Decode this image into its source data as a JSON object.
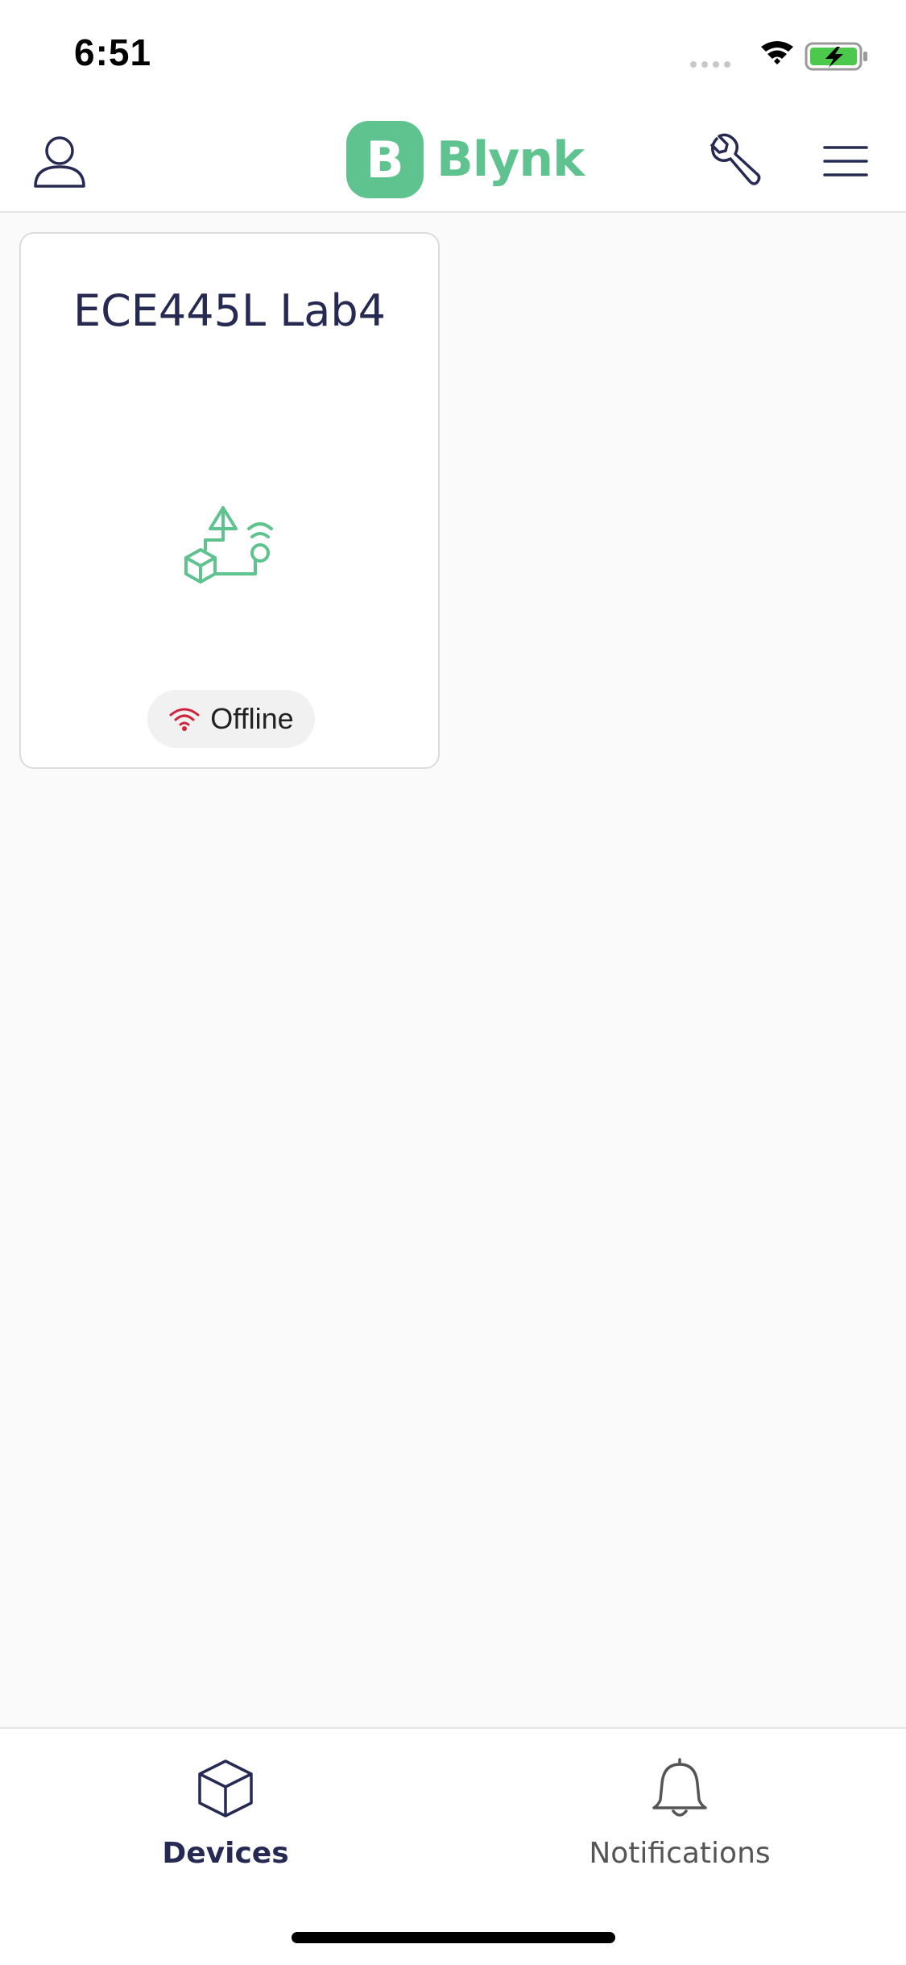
{
  "status_bar": {
    "time": "6:51",
    "icons": [
      "signal-icon",
      "wifi-icon",
      "battery-charging-icon"
    ]
  },
  "header": {
    "logo_badge": "B",
    "logo_text": "Blynk",
    "icons": [
      "profile-icon",
      "wrench-icon",
      "menu-icon"
    ]
  },
  "devices": [
    {
      "name": "ECE445L Lab4",
      "status": "Offline",
      "status_icon": "wifi-off-icon",
      "illustration": "device-template-icon"
    }
  ],
  "tabbar": {
    "tabs": [
      {
        "label": "Devices",
        "icon": "cube-icon",
        "active": true
      },
      {
        "label": "Notifications",
        "icon": "bell-icon",
        "active": false
      }
    ]
  },
  "colors": {
    "brand_green": "#5fc38f",
    "navy": "#262a52",
    "offline_red": "#d0243c",
    "inactive_gray": "#555555"
  }
}
